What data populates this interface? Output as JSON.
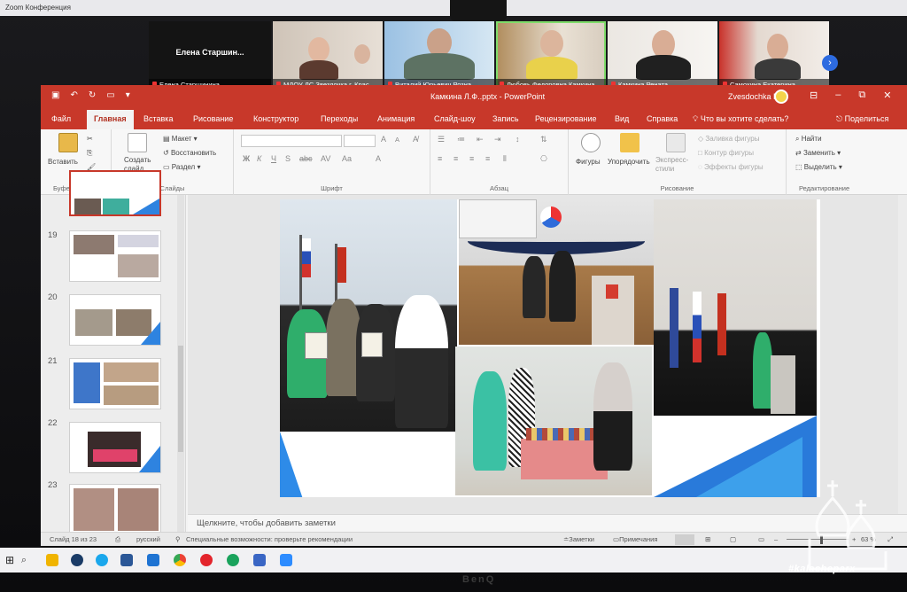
{
  "conference": {
    "window_title": "Zoom Конференция",
    "tile_center_text": "Елена  Старшин...",
    "participants": [
      "Елена Старшинина",
      "МДОУ ДС Звездочка г. Крас...",
      "Виталий Юрьевич Розна",
      "Любовь Федоровна Камкина",
      "Камкина Рената",
      "Самохина Екатерина"
    ]
  },
  "powerpoint": {
    "doc_title": "Камкина Л.Ф..pptx  -  PowerPoint",
    "user_name": "Zvesdochka DS",
    "tabs": [
      "Файл",
      "Главная",
      "Вставка",
      "Рисование",
      "Конструктор",
      "Переходы",
      "Анимация",
      "Слайд-шоу",
      "Запись",
      "Рецензирование",
      "Вид",
      "Справка"
    ],
    "tell_me": "Что вы хотите сделать?",
    "share": "Поделиться",
    "ribbon": {
      "paste": "Вставить",
      "clipboard": "Буфер обмена",
      "create_slide": "Создать слайд",
      "layout": "Макет",
      "reset": "Восстановить",
      "section": "Раздел",
      "slides": "Слайды",
      "font_group": "Шрифт",
      "paragraph_group": "Абзац",
      "shapes": "Фигуры",
      "arrange": "Упорядочить",
      "express_styles": "Экспресс-стили",
      "fill": "Заливка фигуры",
      "outline": "Контур фигуры",
      "effects": "Эффекты фигуры",
      "drawing_group": "Рисование",
      "find": "Найти",
      "replace": "Заменить",
      "select": "Выделить",
      "editing_group": "Редактирование"
    },
    "slide_numbers": [
      "19",
      "20",
      "21",
      "22",
      "23"
    ],
    "notes_placeholder": "Щелкните, чтобы добавить заметки",
    "status": {
      "slide_info": "Слайд 18 из 23",
      "language": "русский",
      "accessibility": "Специальные возможности: проверьте рекомендации",
      "notes_btn": "Заметки",
      "comments_btn": "Примечания",
      "zoom": "63 %"
    }
  },
  "taskbar": {
    "search_glyph": "⌕"
  },
  "monitor_brand": "BenQ",
  "watermark": "#kalacheparx"
}
